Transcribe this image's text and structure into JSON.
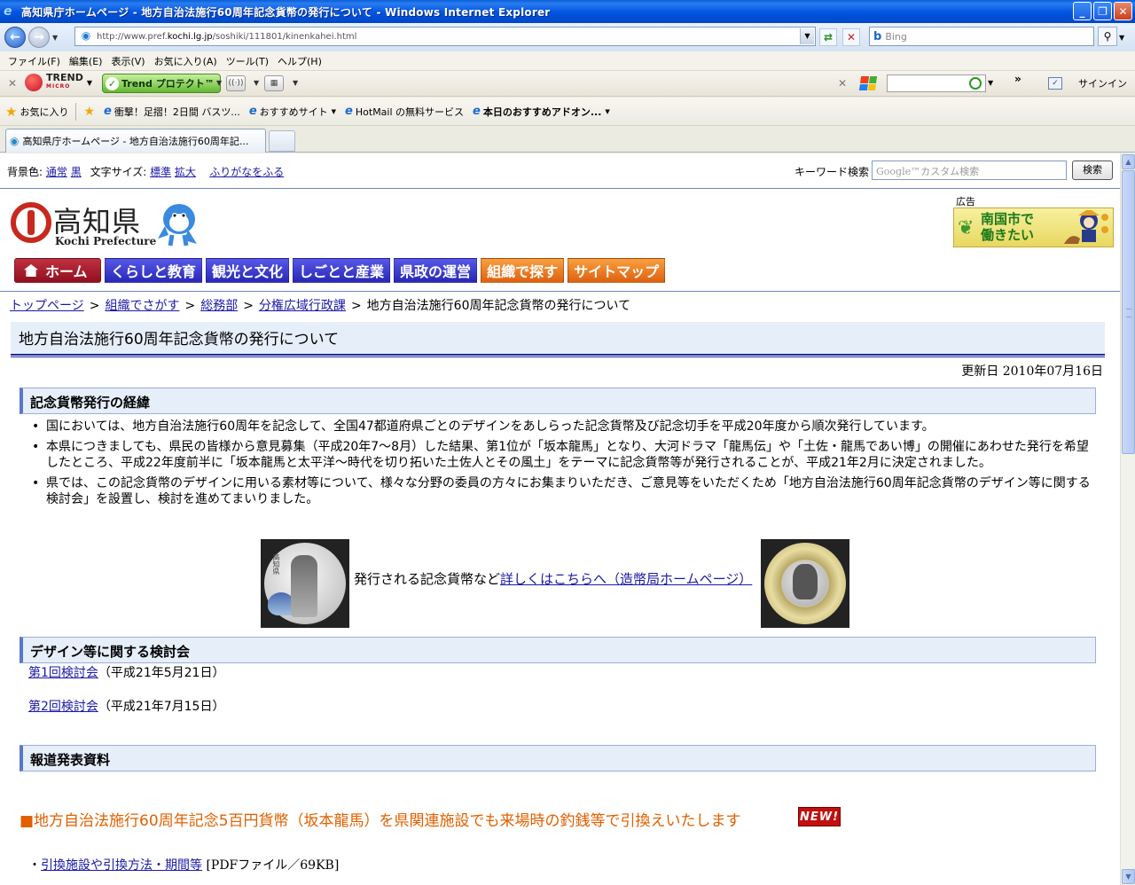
{
  "window": {
    "title": "高知県庁ホームページ - 地方自治法施行60周年記念貨幣の発行について - Windows Internet Explorer",
    "min_label": "_",
    "max_label": "❐",
    "close_label": "✕"
  },
  "address_bar": {
    "url_prefix": "http://www.pref.",
    "url_domain": "kochi.lg.jp",
    "url_suffix": "/soshiki/111801/kinenkahei.html"
  },
  "search_box": {
    "placeholder": "Bing"
  },
  "menu": [
    "ファイル(F)",
    "編集(E)",
    "表示(V)",
    "お気に入り(A)",
    "ツール(T)",
    "ヘルプ(H)"
  ],
  "trend_toolbar": {
    "brand": "TREND",
    "brand_sub": "MICRO",
    "protect_label": "Trend プロテクト™",
    "signin_label": "サインイン",
    "chevron": "»"
  },
  "favorites_bar": {
    "favorites_label": "お気に入り",
    "items": [
      {
        "label": "衝撃！足摺！2日間 バスツ...",
        "dropdown": false
      },
      {
        "label": "おすすめサイト",
        "dropdown": true
      },
      {
        "label": "HotMail の無料サービス",
        "dropdown": false
      },
      {
        "label": "本日のおすすめアドオン...",
        "dropdown": true
      }
    ]
  },
  "tab": {
    "label": "高知県庁ホームページ - 地方自治法施行60周年記..."
  },
  "util": {
    "bg_label": "背景色:",
    "bg_normal": "通常",
    "bg_black": "黒",
    "font_label": "文字サイズ:",
    "font_standard": "標準",
    "font_large": "拡大",
    "furigana": "ふりがなをふる",
    "keyword_label": "キーワード検索",
    "google_placeholder_brand": "Google™",
    "google_placeholder": "カスタム検索",
    "search_button": "検索"
  },
  "logo": {
    "kanji": "高知県",
    "english": "Kochi Prefecture"
  },
  "ad": {
    "label": "広告",
    "line1": "南国市で",
    "line2": "働きたい"
  },
  "global_nav": {
    "colors": {
      "home": "#b02030",
      "blue": "#3a3ad0",
      "orange": "#f08020"
    },
    "items": [
      {
        "label": "ホーム",
        "style": "home"
      },
      {
        "label": "くらしと教育",
        "style": "blue"
      },
      {
        "label": "観光と文化",
        "style": "blue"
      },
      {
        "label": "しごとと産業",
        "style": "blue"
      },
      {
        "label": "県政の運営",
        "style": "blue"
      },
      {
        "label": "組織で探す",
        "style": "orange"
      },
      {
        "label": "サイトマップ",
        "style": "orange"
      }
    ]
  },
  "breadcrumb": {
    "items": [
      "トップページ",
      "組織でさがす",
      "総務部",
      "分権広域行政課"
    ],
    "current": "地方自治法施行60周年記念貨幣の発行について",
    "separator": ">"
  },
  "page_title": "地方自治法施行60周年記念貨幣の発行について",
  "updated": "更新日 2010年07月16日",
  "section1": {
    "heading": "記念貨幣発行の経緯",
    "bullets": [
      "国においては、地方自治法施行60周年を記念して、全国47都道府県ごとのデザインをあしらった記念貨幣及び記念切手を平成20年度から順次発行しています。",
      "本県につきましても、県民の皆様から意見募集（平成20年7～8月）した結果、第1位が「坂本龍馬」となり、大河ドラマ「龍馬伝」や「土佐・龍馬であい博」の開催にあわせた発行を希望したところ、平成22年度前半に「坂本龍馬と太平洋～時代を切り拓いた土佐人とその風土」をテーマに記念貨幣等が発行されることが、平成21年2月に決定されました。",
      "県では、この記念貨幣のデザインに用いる素材等について、様々な分野の委員の方々にお集まりいただき、ご意見等をいただくため「地方自治法施行60周年記念貨幣のデザイン等に関する検討会」を設置し、検討を進めてまいりました。"
    ]
  },
  "coins": {
    "caption": "発行される記念貨幣など",
    "link": "詳しくはこちらへ（造幣局ホームページ）",
    "coin1_text": "高知県"
  },
  "section2": {
    "heading": "デザイン等に関する検討会",
    "meetings": [
      {
        "link": "第1回検討会",
        "date": "（平成21年5月21日）"
      },
      {
        "link": "第2回検討会",
        "date": "（平成21年7月15日）"
      }
    ]
  },
  "section3": {
    "heading": "報道発表資料"
  },
  "notice": {
    "text": "■地方自治法施行60周年記念5百円貨幣（坂本龍馬）を県関連施設でも来場時の釣銭等で引換えいたします",
    "badge": "NEW!"
  },
  "pdf": {
    "prefix": "・",
    "link": "引換施設や引換方法・期間等",
    "meta": " [PDFファイル／69KB]"
  }
}
